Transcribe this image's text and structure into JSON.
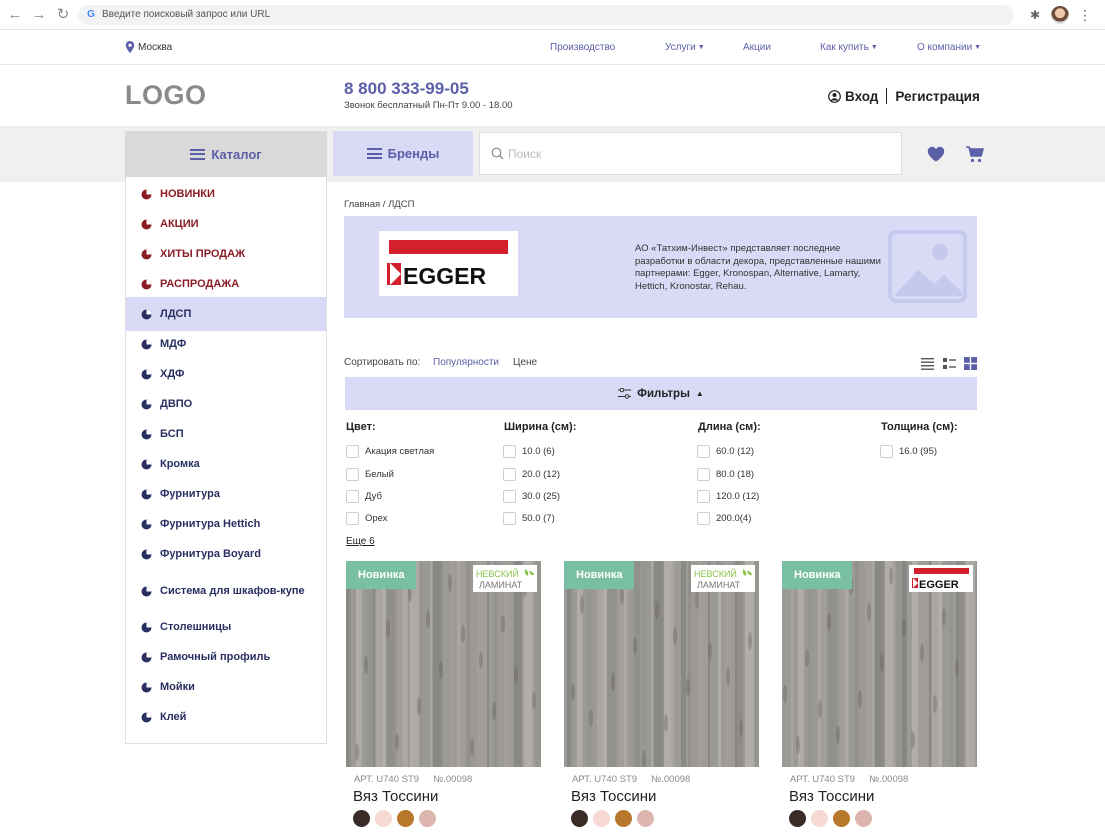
{
  "browser": {
    "url_placeholder": "Введите поисковый запрос или URL"
  },
  "topnav": {
    "city": "Москва",
    "links": [
      {
        "label": "Производство",
        "dropdown": false
      },
      {
        "label": "Услуги",
        "dropdown": true
      },
      {
        "label": "Акции",
        "dropdown": false
      },
      {
        "label": "Как купить",
        "dropdown": true
      },
      {
        "label": "О компании",
        "dropdown": true
      }
    ]
  },
  "header": {
    "logo": "LOGO",
    "phone": "8 800 333-99-05",
    "phone_note": "Звонок бесплатный Пн-Пт  9.00 - 18.00",
    "login": "Вход",
    "register": "Регистрация"
  },
  "toolbar": {
    "catalog": "Каталог",
    "brands": "Бренды",
    "search_placeholder": "Поиск"
  },
  "sidebar": {
    "items": [
      {
        "label": "НОВИНКИ",
        "style": "red"
      },
      {
        "label": "АКЦИИ",
        "style": "red"
      },
      {
        "label": "ХИТЫ ПРОДАЖ",
        "style": "red"
      },
      {
        "label": "РАСПРОДАЖА",
        "style": "red"
      },
      {
        "label": "ЛДСП",
        "style": "active"
      },
      {
        "label": "МДФ",
        "style": "normal"
      },
      {
        "label": "ХДФ",
        "style": "normal"
      },
      {
        "label": "ДВПО",
        "style": "normal"
      },
      {
        "label": "БСП",
        "style": "normal"
      },
      {
        "label": "Кромка",
        "style": "normal"
      },
      {
        "label": "Фурнитура",
        "style": "normal"
      },
      {
        "label": "Фурнитура Hettich",
        "style": "normal"
      },
      {
        "label": "Фурнитура Boyard",
        "style": "normal"
      },
      {
        "label": "Система для шкафов-купе",
        "style": "normal"
      },
      {
        "label": "Столешницы",
        "style": "normal"
      },
      {
        "label": "Рамочный профиль",
        "style": "normal"
      },
      {
        "label": "Мойки",
        "style": "normal"
      },
      {
        "label": "Клей",
        "style": "normal"
      }
    ]
  },
  "main": {
    "breadcrumb": "Главная / ЛДСП",
    "banner": {
      "brand": "EGGER",
      "text": "АО «Татхим-Инвест» представляет последние разработки в области декора, представленные нашими партнерами: Egger, Kronospan, Alternative, Lamarty, Hettich, Kronostar, Rehau."
    },
    "sort": {
      "label": "Сортировать по:",
      "options": [
        "Популярности",
        "Цене"
      ],
      "active": "Популярности"
    },
    "filters_label": "Фильтры",
    "filters": {
      "color": {
        "title": "Цвет:",
        "options": [
          "Акация светлая",
          "Белый",
          "Дуб",
          "Орех"
        ]
      },
      "width": {
        "title": "Ширина (см):",
        "options": [
          "10.0 (6)",
          "20.0 (12)",
          "30.0 (25)",
          "50.0 (7)"
        ]
      },
      "length": {
        "title": "Длина (см):",
        "options": [
          "60.0 (12)",
          "80.0 (18)",
          "120.0 (12)",
          "200.0(4)"
        ]
      },
      "thickness": {
        "title": "Толщина (см):",
        "options": [
          "16.0 (95)"
        ]
      }
    },
    "more": "Еще 6",
    "products": [
      {
        "badge": "Новинка",
        "brand": "nevsky",
        "brand_line1": "НЕВСКИЙ",
        "brand_line2": "ЛАМИНАТ",
        "art": "АРТ. U740 ST9",
        "num": "№.00098",
        "name": "Вяз Тоссини",
        "swatches": [
          "#3a2b28",
          "#f5d9d2",
          "#b8782c",
          "#dcb5ae"
        ]
      },
      {
        "badge": "Новинка",
        "brand": "nevsky",
        "brand_line1": "НЕВСКИЙ",
        "brand_line2": "ЛАМИНАТ",
        "art": "АРТ. U740 ST9",
        "num": "№.00098",
        "name": "Вяз Тоссини",
        "swatches": [
          "#3a2b28",
          "#f5d9d2",
          "#b8782c",
          "#dcb5ae"
        ]
      },
      {
        "badge": "Новинка",
        "brand": "egger",
        "brand_line1": "EGGER",
        "brand_line2": "",
        "art": "АРТ. U740 ST9",
        "num": "№.00098",
        "name": "Вяз Тоссини",
        "swatches": [
          "#3a2b28",
          "#f5d9d2",
          "#b8782c",
          "#dcb5ae"
        ]
      }
    ]
  },
  "colors": {
    "accent": "#5a5fa8",
    "accent_light": "#d8daf6",
    "promo_red": "#8a1d24",
    "badge_green": "#79bfa3",
    "egger_red": "#d4202c"
  }
}
